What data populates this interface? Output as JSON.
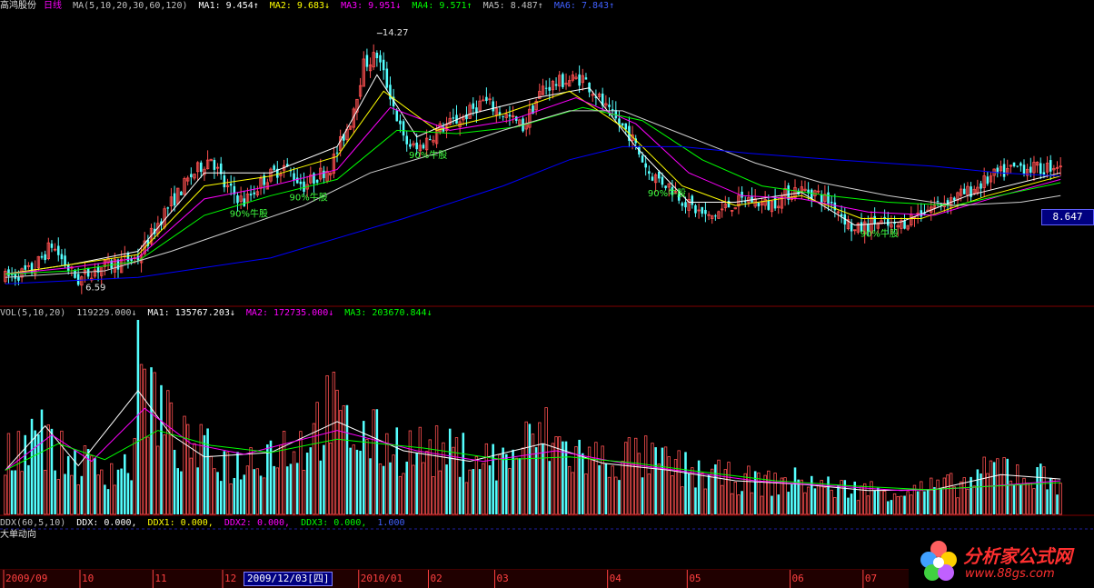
{
  "header": {
    "stock_name": "高鸿股份",
    "period": "日线",
    "ma_label": "MA(5,10,20,30,60,120)",
    "ma1": "MA1: 9.454↑",
    "ma2": "MA2: 9.683↓",
    "ma3": "MA3: 9.951↓",
    "ma4": "MA4: 9.571↑",
    "ma5": "MA5: 8.487↑",
    "ma6": "MA6: 7.843↑"
  },
  "vol_header": {
    "label": "VOL(5,10,20)",
    "value": "119229.000↓",
    "ma1": "MA1: 135767.203↓",
    "ma2": "MA2: 172735.000↓",
    "ma3": "MA3: 203670.844↓"
  },
  "ddx_header": {
    "label": "DDX(60,5,10)",
    "ddx": "DDX: 0.000,",
    "ddx1": "DDX1: 0.000,",
    "ddx2": "DDX2: 0.000,",
    "ddx3": "DDX3: 0.000,",
    "val": "1.000"
  },
  "ddx_sub": "大单动向",
  "current_price": "8.647",
  "cursor_date": "2009/12/03[四]",
  "logo": {
    "name": "分析家公式网",
    "url": "www.88gs.com"
  },
  "colors": {
    "up": "#ff5050",
    "down": "#54ffff",
    "ma1": "#ffffff",
    "ma2": "#ffff00",
    "ma3": "#ff00ff",
    "ma4": "#00ff00",
    "ma5": "#ffffff",
    "ma6": "#0000ff",
    "signal": "#40ff40",
    "axis": "#800000"
  },
  "chart_data": {
    "type": "candlestick",
    "period": "daily",
    "price_axis": {
      "ylim": [
        6.0,
        14.9
      ]
    },
    "x_ticks": [
      "2009/09",
      "10",
      "11",
      "12",
      "2010/01",
      "02",
      "03",
      "04",
      "05",
      "06",
      "07"
    ],
    "annotations": [
      {
        "text": "14.27",
        "kind": "high"
      },
      {
        "text": "6.59",
        "kind": "low"
      },
      {
        "text": "90%牛股",
        "kind": "signal"
      },
      {
        "text": "90%牛股",
        "kind": "signal"
      },
      {
        "text": "90%牛股",
        "kind": "signal"
      },
      {
        "text": "90%牛股",
        "kind": "signal"
      },
      {
        "text": "90%牛股",
        "kind": "signal"
      }
    ],
    "price_path": [
      [
        0,
        6.8
      ],
      [
        8,
        7.0
      ],
      [
        14,
        7.8
      ],
      [
        18,
        7.2
      ],
      [
        22,
        6.7
      ],
      [
        26,
        7.0
      ],
      [
        32,
        7.2
      ],
      [
        40,
        7.4
      ],
      [
        48,
        8.8
      ],
      [
        56,
        9.9
      ],
      [
        62,
        10.5
      ],
      [
        66,
        9.6
      ],
      [
        72,
        9.1
      ],
      [
        78,
        9.8
      ],
      [
        84,
        10.2
      ],
      [
        90,
        9.6
      ],
      [
        98,
        10.2
      ],
      [
        104,
        11.6
      ],
      [
        108,
        13.3
      ],
      [
        112,
        13.6
      ],
      [
        116,
        12.4
      ],
      [
        120,
        11.0
      ],
      [
        124,
        10.7
      ],
      [
        130,
        11.3
      ],
      [
        138,
        11.7
      ],
      [
        144,
        12.2
      ],
      [
        150,
        11.8
      ],
      [
        156,
        11.4
      ],
      [
        162,
        12.6
      ],
      [
        168,
        12.8
      ],
      [
        174,
        12.9
      ],
      [
        178,
        12.4
      ],
      [
        182,
        11.8
      ],
      [
        188,
        11.2
      ],
      [
        194,
        10.0
      ],
      [
        200,
        9.6
      ],
      [
        206,
        9.0
      ],
      [
        212,
        8.6
      ],
      [
        218,
        9.0
      ],
      [
        224,
        9.2
      ],
      [
        230,
        9.0
      ],
      [
        238,
        9.5
      ],
      [
        244,
        9.4
      ],
      [
        250,
        9.0
      ],
      [
        256,
        8.2
      ],
      [
        262,
        8.5
      ],
      [
        268,
        8.3
      ],
      [
        274,
        8.7
      ],
      [
        280,
        9.0
      ],
      [
        290,
        9.4
      ],
      [
        298,
        9.9
      ],
      [
        306,
        10.2
      ],
      [
        312,
        10.1
      ],
      [
        318,
        10.3
      ]
    ],
    "ma_paths": {
      "ma1": [
        [
          0,
          6.9
        ],
        [
          20,
          7.2
        ],
        [
          40,
          7.6
        ],
        [
          60,
          10.0
        ],
        [
          80,
          10.0
        ],
        [
          100,
          10.8
        ],
        [
          112,
          13.0
        ],
        [
          124,
          11.1
        ],
        [
          140,
          11.8
        ],
        [
          160,
          12.3
        ],
        [
          176,
          12.6
        ],
        [
          190,
          10.8
        ],
        [
          206,
          9.1
        ],
        [
          220,
          9.1
        ],
        [
          240,
          9.4
        ],
        [
          256,
          8.4
        ],
        [
          270,
          8.5
        ],
        [
          290,
          9.3
        ],
        [
          318,
          10.0
        ]
      ],
      "ma2": [
        [
          0,
          6.9
        ],
        [
          20,
          7.2
        ],
        [
          40,
          7.5
        ],
        [
          60,
          9.6
        ],
        [
          80,
          9.9
        ],
        [
          100,
          10.5
        ],
        [
          114,
          12.5
        ],
        [
          130,
          11.3
        ],
        [
          150,
          11.8
        ],
        [
          170,
          12.5
        ],
        [
          186,
          11.4
        ],
        [
          204,
          9.6
        ],
        [
          220,
          9.0
        ],
        [
          240,
          9.3
        ],
        [
          258,
          8.6
        ],
        [
          276,
          8.6
        ],
        [
          296,
          9.3
        ],
        [
          318,
          9.9
        ]
      ],
      "ma3": [
        [
          0,
          6.9
        ],
        [
          20,
          7.1
        ],
        [
          40,
          7.4
        ],
        [
          60,
          9.2
        ],
        [
          80,
          9.6
        ],
        [
          100,
          10.1
        ],
        [
          116,
          12.0
        ],
        [
          134,
          11.3
        ],
        [
          152,
          11.6
        ],
        [
          172,
          12.3
        ],
        [
          190,
          11.5
        ],
        [
          206,
          10.0
        ],
        [
          222,
          9.3
        ],
        [
          240,
          9.2
        ],
        [
          260,
          8.8
        ],
        [
          280,
          8.7
        ],
        [
          300,
          9.3
        ],
        [
          318,
          9.8
        ]
      ],
      "ma4": [
        [
          0,
          6.9
        ],
        [
          20,
          7.0
        ],
        [
          40,
          7.3
        ],
        [
          60,
          8.7
        ],
        [
          80,
          9.3
        ],
        [
          100,
          9.8
        ],
        [
          118,
          11.3
        ],
        [
          136,
          11.2
        ],
        [
          154,
          11.4
        ],
        [
          174,
          12.0
        ],
        [
          192,
          11.6
        ],
        [
          210,
          10.4
        ],
        [
          228,
          9.6
        ],
        [
          248,
          9.3
        ],
        [
          266,
          9.1
        ],
        [
          286,
          9.0
        ],
        [
          304,
          9.4
        ],
        [
          318,
          9.7
        ]
      ],
      "ma5": [
        [
          0,
          6.8
        ],
        [
          30,
          7.0
        ],
        [
          50,
          7.6
        ],
        [
          70,
          8.3
        ],
        [
          90,
          9.0
        ],
        [
          110,
          10.0
        ],
        [
          130,
          10.6
        ],
        [
          150,
          11.3
        ],
        [
          170,
          11.9
        ],
        [
          186,
          11.9
        ],
        [
          206,
          11.1
        ],
        [
          226,
          10.3
        ],
        [
          246,
          9.7
        ],
        [
          266,
          9.3
        ],
        [
          286,
          9.0
        ],
        [
          306,
          9.1
        ],
        [
          318,
          9.3
        ]
      ],
      "ma6": [
        [
          0,
          6.6
        ],
        [
          40,
          6.8
        ],
        [
          80,
          7.4
        ],
        [
          120,
          8.6
        ],
        [
          150,
          9.6
        ],
        [
          170,
          10.4
        ],
        [
          186,
          10.8
        ],
        [
          204,
          10.8
        ],
        [
          224,
          10.6
        ],
        [
          250,
          10.4
        ],
        [
          280,
          10.2
        ],
        [
          300,
          10.0
        ],
        [
          318,
          9.9
        ]
      ]
    },
    "volume_axis": {
      "ylim": [
        0,
        220000
      ]
    },
    "volume_profile": [
      [
        0,
        60000
      ],
      [
        10,
        110000
      ],
      [
        14,
        70000
      ],
      [
        20,
        60000
      ],
      [
        30,
        50000
      ],
      [
        38,
        55000
      ],
      [
        40,
        160000
      ],
      [
        46,
        120000
      ],
      [
        52,
        80000
      ],
      [
        60,
        70000
      ],
      [
        70,
        55000
      ],
      [
        80,
        75000
      ],
      [
        90,
        80000
      ],
      [
        98,
        120000
      ],
      [
        102,
        95000
      ],
      [
        110,
        85000
      ],
      [
        120,
        75000
      ],
      [
        130,
        70000
      ],
      [
        140,
        65000
      ],
      [
        150,
        60000
      ],
      [
        162,
        90000
      ],
      [
        170,
        70000
      ],
      [
        180,
        60000
      ],
      [
        190,
        65000
      ],
      [
        200,
        55000
      ],
      [
        210,
        45000
      ],
      [
        220,
        40000
      ],
      [
        230,
        35000
      ],
      [
        240,
        38000
      ],
      [
        250,
        30000
      ],
      [
        260,
        28000
      ],
      [
        270,
        26000
      ],
      [
        280,
        30000
      ],
      [
        290,
        35000
      ],
      [
        300,
        55000
      ],
      [
        310,
        42000
      ],
      [
        318,
        40000
      ]
    ],
    "volume_ma_paths": {
      "ma1": [
        [
          0,
          50000
        ],
        [
          12,
          100000
        ],
        [
          22,
          55000
        ],
        [
          40,
          140000
        ],
        [
          50,
          90000
        ],
        [
          60,
          65000
        ],
        [
          80,
          70000
        ],
        [
          100,
          105000
        ],
        [
          120,
          72000
        ],
        [
          140,
          60000
        ],
        [
          162,
          80000
        ],
        [
          180,
          58000
        ],
        [
          200,
          50000
        ],
        [
          220,
          38000
        ],
        [
          240,
          34000
        ],
        [
          260,
          27000
        ],
        [
          280,
          28000
        ],
        [
          300,
          45000
        ],
        [
          318,
          40000
        ]
      ],
      "ma2": [
        [
          0,
          50000
        ],
        [
          14,
          90000
        ],
        [
          26,
          60000
        ],
        [
          42,
          120000
        ],
        [
          56,
          80000
        ],
        [
          72,
          68000
        ],
        [
          100,
          95000
        ],
        [
          124,
          72000
        ],
        [
          144,
          60000
        ],
        [
          166,
          72000
        ],
        [
          186,
          58000
        ],
        [
          206,
          48000
        ],
        [
          226,
          38000
        ],
        [
          250,
          32000
        ],
        [
          270,
          27000
        ],
        [
          290,
          30000
        ],
        [
          318,
          38000
        ]
      ],
      "ma3": [
        [
          0,
          50000
        ],
        [
          16,
          80000
        ],
        [
          30,
          62000
        ],
        [
          46,
          95000
        ],
        [
          62,
          78000
        ],
        [
          80,
          70000
        ],
        [
          100,
          85000
        ],
        [
          126,
          75000
        ],
        [
          150,
          62000
        ],
        [
          170,
          65000
        ],
        [
          190,
          58000
        ],
        [
          210,
          48000
        ],
        [
          232,
          38000
        ],
        [
          256,
          32000
        ],
        [
          278,
          28000
        ],
        [
          298,
          32000
        ],
        [
          318,
          36000
        ]
      ]
    }
  }
}
